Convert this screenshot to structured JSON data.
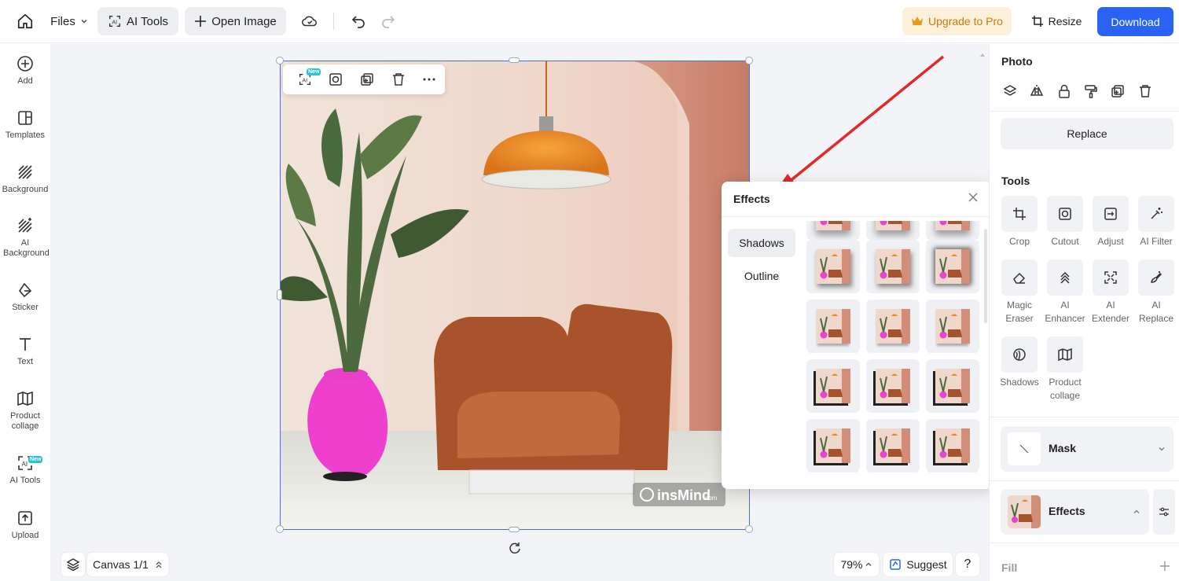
{
  "topbar": {
    "files_label": "Files",
    "ai_tools_label": "AI Tools",
    "open_image_label": "Open Image",
    "upgrade_label": "Upgrade to Pro",
    "resize_label": "Resize",
    "download_label": "Download"
  },
  "leftbar": {
    "items": [
      {
        "label": "Add",
        "icon": "plus-circle-icon"
      },
      {
        "label": "Templates",
        "icon": "templates-icon"
      },
      {
        "label": "Background",
        "icon": "background-icon"
      },
      {
        "label": "AI Background",
        "icon": "ai-background-icon"
      },
      {
        "label": "Sticker",
        "icon": "sticker-icon"
      },
      {
        "label": "Text",
        "icon": "text-icon"
      },
      {
        "label": "Product collage",
        "icon": "collage-icon"
      },
      {
        "label": "AI Tools",
        "icon": "ai-tools-icon",
        "badge": "New"
      },
      {
        "label": "Upload",
        "icon": "upload-icon"
      }
    ]
  },
  "float_toolbar": {
    "ai_badge": "New",
    "ai_label": "AI"
  },
  "photo": {
    "watermark": "insMind",
    "watermark_suffix": ".com"
  },
  "effects_popup": {
    "title": "Effects",
    "tabs": [
      "Shadows",
      "Outline"
    ],
    "active_tab": "Shadows"
  },
  "bottombar": {
    "canvas_label": "Canvas 1/1",
    "zoom_label": "79%",
    "suggest_label": "Suggest",
    "help_label": "?"
  },
  "rightpanel": {
    "photo_title": "Photo",
    "replace_label": "Replace",
    "tools_title": "Tools",
    "tools": [
      {
        "label": "Crop",
        "icon": "crop-icon"
      },
      {
        "label": "Cutout",
        "icon": "cutout-icon"
      },
      {
        "label": "Adjust",
        "icon": "adjust-icon"
      },
      {
        "label": "AI Filter",
        "icon": "ai-filter-icon"
      },
      {
        "label": "Magic Eraser",
        "icon": "eraser-icon"
      },
      {
        "label": "AI Enhancer",
        "icon": "enhancer-icon"
      },
      {
        "label": "AI Extender",
        "icon": "extender-icon"
      },
      {
        "label": "AI Replace",
        "icon": "ai-replace-icon"
      },
      {
        "label": "Shadows",
        "icon": "shadows-icon"
      },
      {
        "label": "Product collage",
        "icon": "collage-icon"
      }
    ],
    "mask_label": "Mask",
    "effects_label": "Effects",
    "fill_label": "Fill"
  },
  "colors": {
    "accent": "#2962f5",
    "upgrade_bg": "#fdf0db",
    "upgrade_text": "#c97a12",
    "arrow": "#e02a2a",
    "selection": "#4a6cf7"
  }
}
